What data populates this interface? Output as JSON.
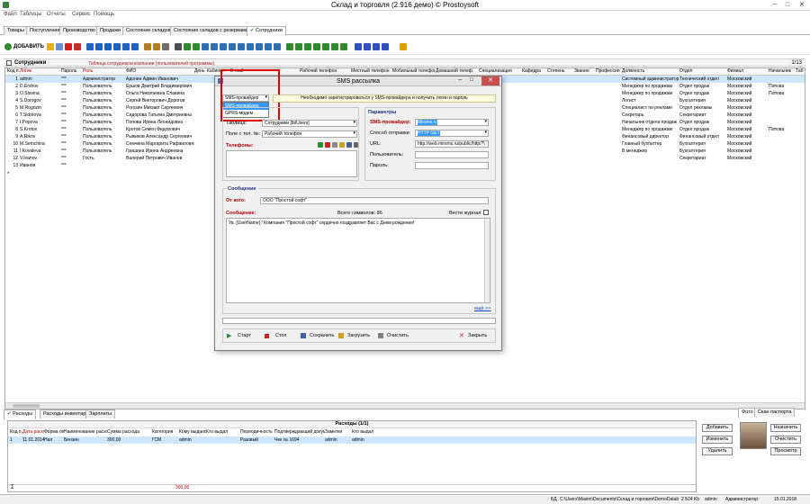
{
  "window": {
    "title": "Склад и торговля (2.916 демо) © Prostoysoft"
  },
  "menu": [
    "Файл",
    "Таблицы",
    "Отчеты",
    "Сервис",
    "Помощь"
  ],
  "tabs": [
    "Товары",
    "Поступления",
    "Производство",
    "Продажи",
    "Состояние складов",
    "Состояние складов с резервами",
    "Сотрудники"
  ],
  "toolbar": {
    "add_label": "ДОБАВИТЬ"
  },
  "grid": {
    "title": "Сотрудники",
    "subtitle": "Таблица сотрудников компании (пользователей программы)",
    "counter": "1/13",
    "headers": [
      "Код п.",
      "Логин",
      "Пароль",
      "Роль",
      "ФИО",
      "День",
      "Кабинет",
      "E-mail",
      "Рабочий телефон",
      "Местный телефон",
      "Мобильный телефон",
      "Домашний телеф.",
      "Специализация",
      "Кафедра",
      "Степень",
      "Звание",
      "Профессия",
      "Должность",
      "Отдел",
      "Филиал",
      "Начальник",
      "Таб"
    ],
    "rows": [
      {
        "id": "1",
        "login": "admin",
        "pwd": "***",
        "role": "Администратор",
        "fio": "Адонин Админ Иванович",
        "post": "Системный администратор",
        "dept": "Технический отдел",
        "branch": "Московский",
        "boss": ""
      },
      {
        "id": "2",
        "login": "D.Ershov",
        "pwd": "***",
        "role": "Пользователь",
        "fio": "Ершов Дмитрий Владимирович",
        "post": "Менеджер по продажам",
        "dept": "Отдел продаж",
        "branch": "Московский",
        "boss": "Попова"
      },
      {
        "id": "3",
        "login": "O.Slavina",
        "pwd": "***",
        "role": "Пользователь",
        "fio": "Ольга Николаевна Славина",
        "post": "Менеджер по продажам",
        "dept": "Отдел продаж",
        "branch": "Московский",
        "boss": "Попова"
      },
      {
        "id": "4",
        "login": "S.Dorogov",
        "pwd": "***",
        "role": "Пользователь",
        "fio": "Сергей Викторович Дорогов",
        "post": "Логист",
        "dept": "Бухгалтерия",
        "branch": "Московский",
        "boss": ""
      },
      {
        "id": "5",
        "login": "M.Rogozin",
        "pwd": "***",
        "role": "Пользователь",
        "fio": "Рогозин Михаил Сергеевич",
        "post": "Специалист по рекламе",
        "dept": "Отдел рекламы",
        "branch": "Московский",
        "boss": ""
      },
      {
        "id": "6",
        "login": "T.Sidorova",
        "pwd": "***",
        "role": "Пользователь",
        "fio": "Сидорова Татьяна Дмитриевна",
        "post": "Секретарь",
        "dept": "Секретариат",
        "branch": "Московский",
        "boss": ""
      },
      {
        "id": "7",
        "login": "I.Popova",
        "pwd": "***",
        "role": "Пользователь",
        "fio": "Попова Ирина Леонидовна",
        "post": "Начальник отдела продаж",
        "dept": "Отдел продаж",
        "branch": "Московский",
        "boss": ""
      },
      {
        "id": "8",
        "login": "S.Krotov",
        "pwd": "***",
        "role": "Пользователь",
        "fio": "Кротов Семен Федорович",
        "post": "Менеджер по продажам",
        "dept": "Отдел продаж",
        "branch": "Московский",
        "boss": "Попова"
      },
      {
        "id": "9",
        "login": "A.Rikov",
        "pwd": "***",
        "role": "Пользователь",
        "fio": "Рыжиков Александр Сергеевич",
        "post": "Финансовый директор",
        "dept": "Финансовый отдел",
        "branch": "Московский",
        "boss": ""
      },
      {
        "id": "10",
        "login": "M.Semchina",
        "pwd": "***",
        "role": "Пользователь",
        "fio": "Семчина Маргарита Рафаиловна",
        "post": "Главный бухгалтер",
        "dept": "Бухгалтерия",
        "branch": "Московский",
        "boss": ""
      },
      {
        "id": "11",
        "login": "I.Kovaleva",
        "pwd": "***",
        "role": "Пользователь",
        "fio": "Гришина Ирина Андреевна",
        "post": "В.менеджер",
        "dept": "Бухгалтерия",
        "branch": "Московский",
        "boss": ""
      },
      {
        "id": "12",
        "login": "V.Ivanov",
        "pwd": "***",
        "role": "Гость",
        "fio": "Валерий Петрович Иванов",
        "post": "",
        "dept": "Секретариат",
        "branch": "Московский",
        "boss": ""
      },
      {
        "id": "13",
        "login": "Иванов",
        "pwd": "***",
        "role": "",
        "fio": "",
        "post": "",
        "dept": "",
        "branch": "",
        "boss": ""
      }
    ]
  },
  "sms_dialog": {
    "title": "SMS рассылка",
    "provider_select": "SMS-провайдер",
    "provider_options": [
      "SMS-провайдер",
      "GPRS-модем"
    ],
    "info_note": "Необходимо зарегистрироваться у SMS-провайдера и получить логин и пароль",
    "table_label": "Таблица:",
    "table_value": "Сотрудники [tblUsers]",
    "phone_field_label": "Поле с тел. №:",
    "phone_field_value": "Рабочий телефон",
    "phones_label": "Телефоны:",
    "params_title": "Параметры",
    "sms_provider_label": "SMS-провайдер:",
    "sms_provider_value": "Mirsms.ru",
    "send_method_label": "Способ отправки:",
    "send_method_value": "HTTP GET",
    "url_label": "URL:",
    "url_value": "http://web.mirsms.ru/public/http/?\\",
    "user_label": "Пользователь:",
    "password_label": "Пароль:",
    "message_title": "Сообщение",
    "from_label": "От кого:",
    "from_value": "ООО \"Простой софт\"",
    "message_label": "Сообщение:",
    "char_count": "Всего символов: 86",
    "journal_label": "Вести журнал",
    "message_text": "Ув. [UserName] ! Компания \"Простой софт\" сердечно поздравляет Вас с Днем рождения!",
    "more_link": "ещё >>",
    "buttons": {
      "start": "Старт",
      "stop": "Стоп",
      "save": "Сохранить",
      "load": "Загрузить",
      "clear": "Очистить",
      "close": "Закрыть"
    }
  },
  "bottom": {
    "tabs": [
      "Расходы",
      "Расходы инвентаря",
      "Зарплаты"
    ],
    "grid_title": "Расходы (1/1)",
    "headers": [
      "Код п.",
      "Дата расхода",
      "Форма оплаты",
      "Наименование расхода",
      "Сумма расхода",
      "Категория",
      "Кому выдано",
      "Кто выдал",
      "Периодичность",
      "Подтверждающий документ",
      "Заметки",
      "Кто выдал"
    ],
    "row": [
      "1",
      "11.01.2014",
      "Нал",
      "Бензин",
      "300,00",
      "ГСМ",
      "admin",
      "",
      "Разовый",
      "Чек № 1694",
      "admin",
      "admin"
    ],
    "total": "300,00",
    "sigma": "Σ",
    "buttons": [
      "Добавить",
      "Изменить",
      "Удалить"
    ],
    "photo_tabs": [
      "Фото",
      "Скан паспорта"
    ],
    "photo_buttons": [
      "Назначить",
      "Очистить",
      "Просмотр"
    ]
  },
  "status": {
    "mode": "БД",
    "path": "C:\\Users\\Maxim\\Documents\\Склад и торговля\\DemoDatabase.mdb",
    "size": "2 524 Kb",
    "user": "admin",
    "role": "Администратор",
    "date": "15.01.2018"
  },
  "colors": {
    "accent": "#3399ff",
    "highlight": "#e00000",
    "toolbar_green": "#2e8b2e"
  }
}
